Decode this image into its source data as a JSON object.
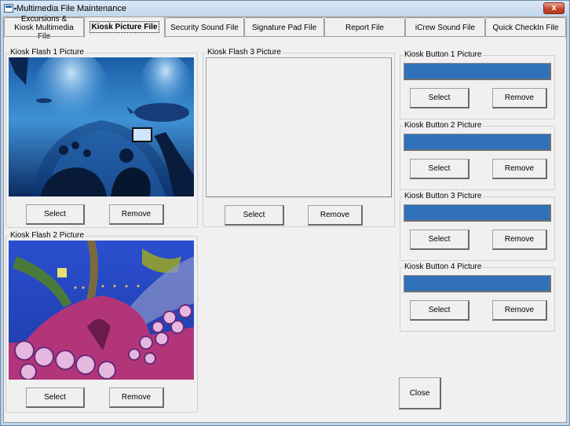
{
  "window": {
    "title": "Multimedia File Maintenance",
    "close_label": "x"
  },
  "tabs": [
    {
      "label": "Excursions & Kiosk Multimedia File",
      "active": false
    },
    {
      "label": "Kiosk Picture File",
      "active": true
    },
    {
      "label": "Security Sound File",
      "active": false
    },
    {
      "label": "Signature Pad File",
      "active": false
    },
    {
      "label": "Report File",
      "active": false
    },
    {
      "label": "iCrew Sound File",
      "active": false
    },
    {
      "label": "Quick CheckIn File",
      "active": false
    }
  ],
  "flash_pictures": [
    {
      "label": "Kiosk Flash 1 Picture",
      "image": "aquarium-tunnel-photo",
      "select_label": "Select",
      "remove_label": "Remove"
    },
    {
      "label": "Kiosk Flash 2 Picture",
      "image": "octopus-photo",
      "select_label": "Select",
      "remove_label": "Remove"
    },
    {
      "label": "Kiosk Flash 3 Picture",
      "image": "",
      "select_label": "Select",
      "remove_label": "Remove"
    }
  ],
  "button_pictures": [
    {
      "label": "Kiosk Button 1 Picture",
      "select_label": "Select",
      "remove_label": "Remove"
    },
    {
      "label": "Kiosk Button 2 Picture",
      "select_label": "Select",
      "remove_label": "Remove"
    },
    {
      "label": "Kiosk Button 3 Picture",
      "select_label": "Select",
      "remove_label": "Remove"
    },
    {
      "label": "Kiosk Button 4 Picture",
      "select_label": "Select",
      "remove_label": "Remove"
    }
  ],
  "colors": {
    "button_picture_fill": "#3070b8"
  },
  "close_label": "Close"
}
